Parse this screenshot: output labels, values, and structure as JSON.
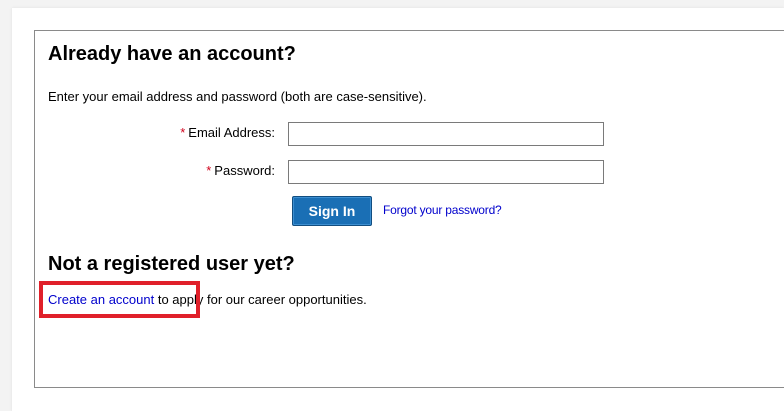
{
  "existing_account": {
    "heading": "Already have an account?",
    "instructions": "Enter your email address and password (both are case-sensitive).",
    "required_marker": "*",
    "email_label": "Email Address:",
    "email_value": "",
    "password_label": "Password:",
    "password_value": "",
    "sign_in_label": "Sign In",
    "forgot_password_link": "Forgot your password?"
  },
  "new_user": {
    "heading": "Not a registered user yet?",
    "create_account_link": "Create an account",
    "create_account_suffix": " to apply for our career opportunities."
  },
  "colors": {
    "required_marker": "#d0021b",
    "sign_in_button": "#1a6fb5",
    "link": "#0000cc",
    "highlight": "#e0202a"
  }
}
